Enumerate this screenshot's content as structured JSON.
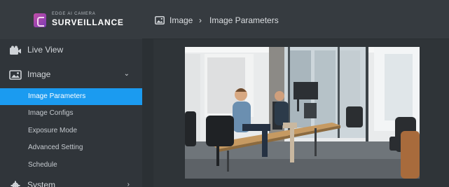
{
  "brand": {
    "subtitle": "EDGE AI CAMERA",
    "title": "SURVEILLANCE"
  },
  "sidebar": {
    "items": [
      {
        "label": "Live View",
        "icon": "video-icon"
      },
      {
        "label": "Image",
        "icon": "image-icon",
        "expanded": true
      },
      {
        "label": "System",
        "icon": "gear-icon"
      }
    ],
    "image_submenu": [
      {
        "label": "Image Parameters",
        "active": true
      },
      {
        "label": "Image Configs"
      },
      {
        "label": "Exposure Mode"
      },
      {
        "label": "Advanced Setting"
      },
      {
        "label": "Schedule"
      }
    ]
  },
  "breadcrumb": {
    "icon": "image-icon",
    "items": [
      "Image",
      "Image Parameters"
    ],
    "separator": "›"
  },
  "preview": {
    "subject": "office-workers-camera-preview"
  },
  "colors": {
    "accent": "#1b9bf0",
    "sidebar": "#30353a",
    "header": "#363b40",
    "brand_gradient": [
      "#c44fa9",
      "#7a3bb2"
    ]
  }
}
